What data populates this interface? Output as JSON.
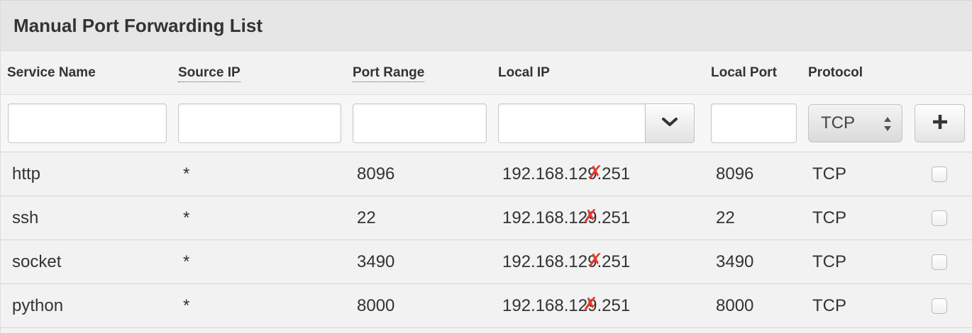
{
  "panel": {
    "title": "Manual Port Forwarding List"
  },
  "columns": {
    "service_name": "Service Name",
    "source_ip": "Source IP",
    "port_range": "Port Range",
    "local_ip": "Local IP",
    "local_port": "Local Port",
    "protocol": "Protocol"
  },
  "form": {
    "service_name_value": "",
    "source_ip_value": "",
    "port_range_value": "",
    "local_ip_value": "",
    "local_port_value": "",
    "protocol_selected": "TCP",
    "add_button_icon": "plus-icon",
    "local_ip_dropdown_icon": "chevron-down-icon"
  },
  "rows": [
    {
      "service": "http",
      "source_ip": "*",
      "port_range": "8096",
      "local_ip_prefix": "192.168.1",
      "local_ip_suffix": "9.251",
      "local_port": "8096",
      "protocol": "TCP"
    },
    {
      "service": "ssh",
      "source_ip": "*",
      "port_range": "22",
      "local_ip_prefix": "192.168.1",
      "local_ip_suffix": "9.251",
      "local_port": "22",
      "protocol": "TCP"
    },
    {
      "service": "socket",
      "source_ip": "*",
      "port_range": "3490",
      "local_ip_prefix": "192.168.1",
      "local_ip_suffix": "9.251",
      "local_port": "3490",
      "protocol": "TCP"
    },
    {
      "service": "python",
      "source_ip": "*",
      "port_range": "8000",
      "local_ip_prefix": "192.168.1",
      "local_ip_suffix": "9.251",
      "local_port": "8000",
      "protocol": "TCP"
    }
  ],
  "colors": {
    "redaction_mark": "#e53b2f",
    "header_bg": "#e6e6e6"
  }
}
